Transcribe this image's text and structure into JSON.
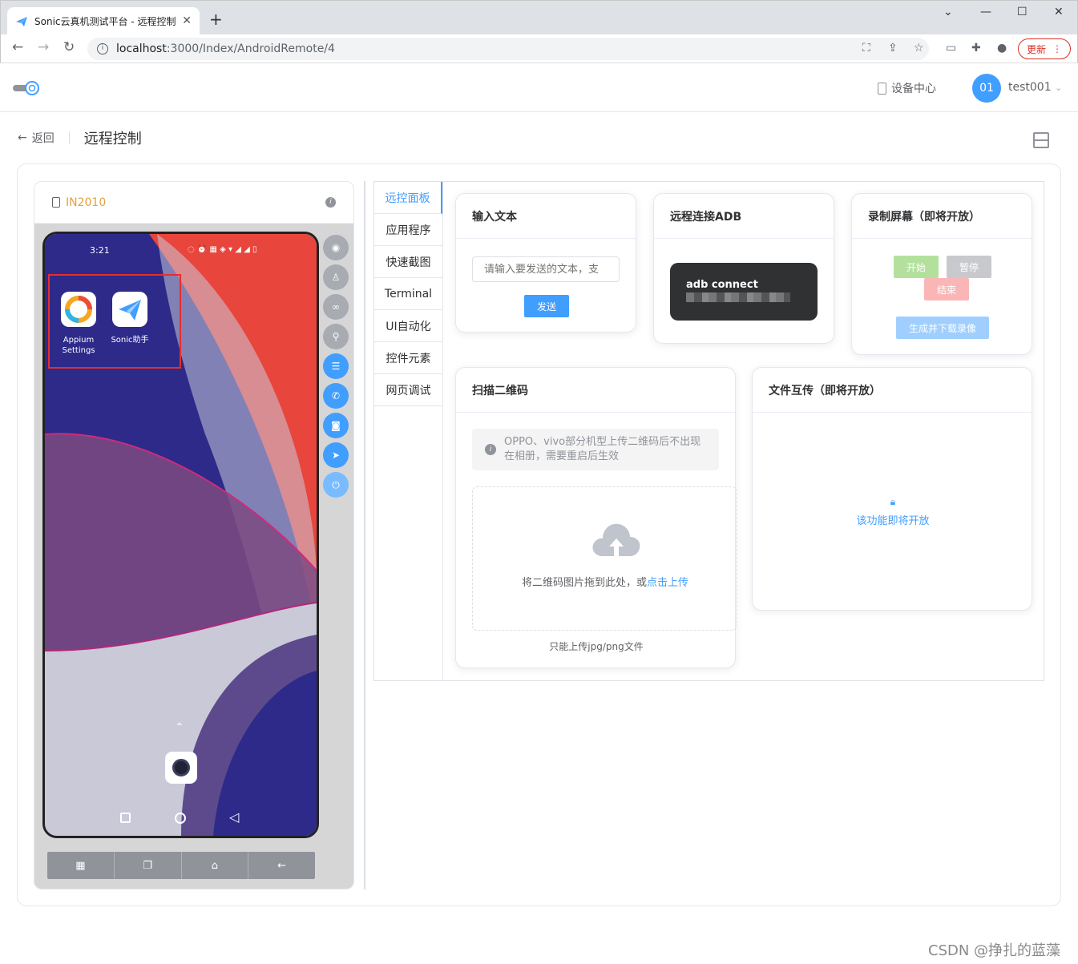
{
  "browser": {
    "tab_title": "Sonic云真机测试平台 - 远程控制",
    "url_host": "localhost",
    "url_path": ":3000/Index/AndroidRemote/4",
    "update_label": "更新"
  },
  "header": {
    "device_center": "设备中心",
    "avatar_text": "01",
    "username": "test001"
  },
  "page": {
    "back_label": "返回",
    "title": "远程控制"
  },
  "device": {
    "model": "IN2010",
    "status_time": "3:21",
    "apps": [
      {
        "name": "Appium Settings"
      },
      {
        "name": "Sonic助手"
      }
    ]
  },
  "tabs": [
    "远控面板",
    "应用程序",
    "快速截图",
    "Terminal",
    "UI自动化",
    "控件元素",
    "网页调试"
  ],
  "cards": {
    "input_text": {
      "title": "输入文本",
      "placeholder": "请输入要发送的文本，支",
      "send_label": "发送"
    },
    "adb": {
      "title": "远程连接ADB",
      "command": "adb connect"
    },
    "record": {
      "title": "录制屏幕（即将开放）",
      "start": "开始",
      "pause": "暂停",
      "stop": "结束",
      "download": "生成并下载录像"
    },
    "qrcode": {
      "title": "扫描二维码",
      "notice": "OPPO、vivo部分机型上传二维码后不出现在相册，需要重启后生效",
      "drop_text": "将二维码图片拖到此处，或",
      "upload_link": "点击上传",
      "tip": "只能上传jpg/png文件"
    },
    "file": {
      "title": "文件互传（即将开放）",
      "coming": "该功能即将开放"
    }
  },
  "watermark": "CSDN @挣扎的蓝藻",
  "colors": {
    "primary": "#409eff",
    "warning": "#e6a23c",
    "success_light": "#b3e19d",
    "danger_light": "#fab6b6"
  }
}
